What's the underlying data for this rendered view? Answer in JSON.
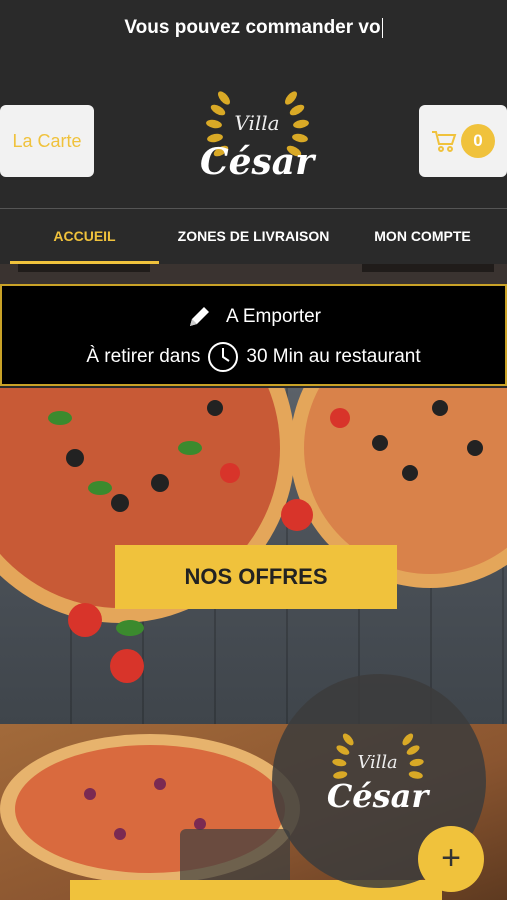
{
  "marquee": {
    "text": "Vous pouvez commander vo"
  },
  "header": {
    "carte_label": "La Carte",
    "cart_count": "0",
    "logo_top": "Villa",
    "logo_bottom": "César"
  },
  "nav": [
    {
      "label": "ACCUEIL",
      "active": true
    },
    {
      "label": "ZONES DE LIVRAISON",
      "active": false
    },
    {
      "label": "MON COMPTE",
      "active": false
    }
  ],
  "info": {
    "mode": "A Emporter",
    "pickup_prefix": "À retirer dans",
    "pickup_suffix": "30 Min au restaurant"
  },
  "hero": {
    "button_label": "NOS OFFRES"
  },
  "fab": {
    "label": "+"
  },
  "colors": {
    "accent": "#f0c23c",
    "dark": "#2a2a2a"
  }
}
